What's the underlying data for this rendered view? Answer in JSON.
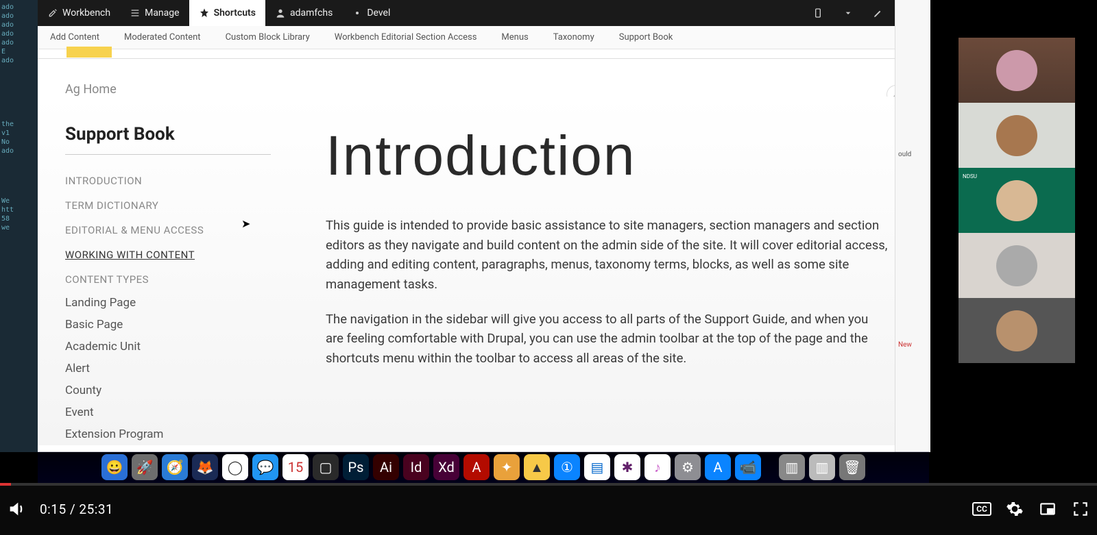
{
  "admin": {
    "workbench": "Workbench",
    "manage": "Manage",
    "shortcuts": "Shortcuts",
    "user": "adamfchs",
    "devel": "Devel",
    "edit": "Edit"
  },
  "secondary": [
    "Add Content",
    "Moderated Content",
    "Custom Block Library",
    "Workbench Editorial Section Access",
    "Menus",
    "Taxonomy",
    "Support Book"
  ],
  "breadcrumb": "Ag Home",
  "sidebar": {
    "title": "Support Book",
    "main": [
      "INTRODUCTION",
      "TERM DICTIONARY",
      "EDITORIAL & MENU ACCESS",
      "WORKING WITH CONTENT",
      "CONTENT TYPES"
    ],
    "active_index": 3,
    "sub": [
      "Landing Page",
      "Basic Page",
      "Academic Unit",
      "Alert",
      "County",
      "Event",
      "Extension Program"
    ]
  },
  "main": {
    "heading": "Introduction",
    "p1": "This guide is intended to provide basic assistance to site managers, section managers and section editors as they navigate and build content on the admin side of the site. It will cover editorial access, adding and editing content, paragraphs, menus, taxonomy terms, blocks, as well as some site management tasks.",
    "p2": "The navigation in the sidebar will give you access to all parts of the Support Guide, and when you are feeling comfortable with Drupal, you can use the admin toolbar at the top of the page and the shortcuts menu within the toolbar to access all areas of the site."
  },
  "player": {
    "current": "0:15",
    "total": "25:31",
    "cc": "CC"
  },
  "right_peek": {
    "ould": "ould",
    "new": "New"
  },
  "webcams": {
    "ndsu": "NDSU"
  },
  "dock_colors": [
    "#2a6fd6",
    "#6e6e6e",
    "#2a7bd6",
    "#ff6a2a",
    "#e33",
    "#35a853",
    "#2196f3",
    "#fff",
    "#3a3a3a",
    "#001e36",
    "#330000",
    "#49021f",
    "#470137",
    "#b30b00",
    "#e9a13b",
    "#f7c948",
    "#0a84ff",
    "#1e90ff",
    "#7a4fbf",
    "#8e8e93",
    "#444",
    "#0a84ff",
    "#0a84ff",
    "#888",
    "#bbb",
    "#777"
  ]
}
